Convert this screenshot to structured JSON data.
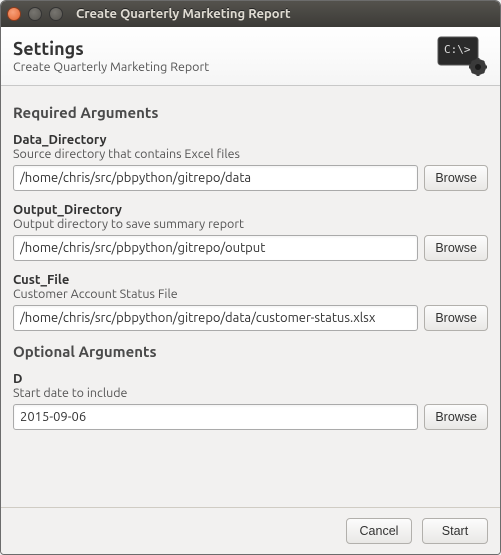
{
  "window": {
    "title": "Create Quarterly Marketing Report"
  },
  "header": {
    "title": "Settings",
    "subtitle": "Create Quarterly Marketing Report"
  },
  "sections": {
    "required_title": "Required Arguments",
    "optional_title": "Optional Arguments"
  },
  "args": {
    "data_dir": {
      "name": "Data_Directory",
      "desc": "Source directory that contains Excel files",
      "value": "/home/chris/src/pbpython/gitrepo/data"
    },
    "output_dir": {
      "name": "Output_Directory",
      "desc": "Output directory to save summary report",
      "value": "/home/chris/src/pbpython/gitrepo/output"
    },
    "cust_file": {
      "name": "Cust_File",
      "desc": "Customer Account Status File",
      "value": "/home/chris/src/pbpython/gitrepo/data/customer-status.xlsx"
    },
    "d": {
      "name": "D",
      "desc": "Start date to include",
      "value": "2015-09-06"
    }
  },
  "buttons": {
    "browse": "Browse",
    "cancel": "Cancel",
    "start": "Start"
  }
}
